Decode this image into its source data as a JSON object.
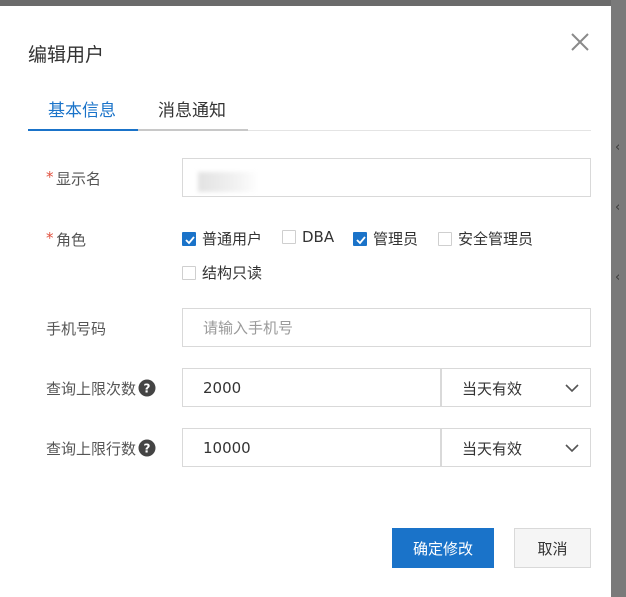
{
  "dialog": {
    "title": "编辑用户"
  },
  "tabs": [
    {
      "label": "基本信息",
      "active": true
    },
    {
      "label": "消息通知",
      "active": false
    }
  ],
  "form": {
    "display_name": {
      "label": "显示名",
      "required": true,
      "value": ""
    },
    "role": {
      "label": "角色",
      "required": true,
      "options": [
        {
          "label": "普通用户",
          "checked": true
        },
        {
          "label": "DBA",
          "checked": false
        },
        {
          "label": "管理员",
          "checked": true
        },
        {
          "label": "安全管理员",
          "checked": false
        },
        {
          "label": "结构只读",
          "checked": false
        }
      ]
    },
    "phone": {
      "label": "手机号码",
      "value": "",
      "placeholder": "请输入手机号"
    },
    "query_limit_count": {
      "label": "查询上限次数",
      "value": "2000",
      "period": "当天有效"
    },
    "query_limit_rows": {
      "label": "查询上限行数",
      "value": "10000",
      "period": "当天有效"
    }
  },
  "buttons": {
    "confirm": "确定修改",
    "cancel": "取消"
  },
  "colors": {
    "primary": "#1a73c9",
    "required": "#e0503e"
  },
  "icons": {
    "close": "close-icon",
    "help": "question-circle-icon",
    "dropdown": "chevron-down-icon",
    "check": "checkmark-icon"
  }
}
